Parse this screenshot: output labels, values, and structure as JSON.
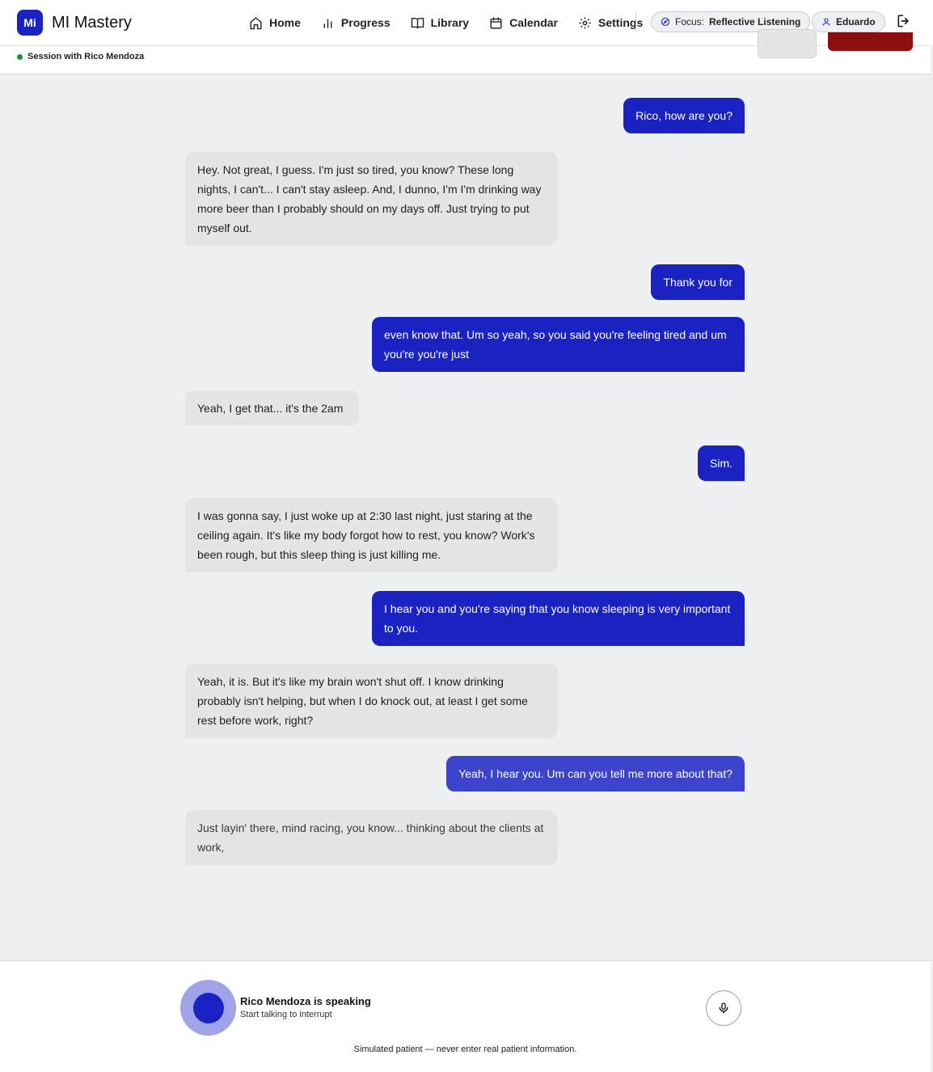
{
  "app": {
    "logo_text": "Mi",
    "title": "MI Mastery",
    "brand_color": "#1a22c4"
  },
  "nav": {
    "items": [
      {
        "label": "Home",
        "icon": "home-icon"
      },
      {
        "label": "Progress",
        "icon": "bar-chart-icon"
      },
      {
        "label": "Library",
        "icon": "book-icon"
      },
      {
        "label": "Calendar",
        "icon": "calendar-icon"
      },
      {
        "label": "Settings",
        "icon": "gear-icon"
      }
    ],
    "focus_prefix": "Focus:",
    "focus_value": "Reflective Listening",
    "user_name": "Eduardo"
  },
  "session": {
    "label": "Session with Rico Mendoza",
    "status_color": "#1e8c3a"
  },
  "messages": [
    {
      "role": "user",
      "text": "Rico, how are you?"
    },
    {
      "role": "patient",
      "text": "Hey. Not great, I guess. I'm just so tired, you know? These long nights, I can't... I can't stay asleep. And, I dunno, I'm I'm drinking way more beer than I probably should on my days off. Just trying to put myself out."
    },
    {
      "role": "user",
      "text": "Thank you for"
    },
    {
      "role": "user",
      "text": "even know that. Um so yeah, so you said you're feeling tired and um you're you're just"
    },
    {
      "role": "patient",
      "text": "Yeah, I get that... it's the 2am"
    },
    {
      "role": "user",
      "text": "Sim."
    },
    {
      "role": "patient",
      "text": "I was gonna say, I just woke up at 2:30 last night, just staring at the ceiling again. It's like my body forgot how to rest, you know? Work's been rough, but this sleep thing is just killing me."
    },
    {
      "role": "user",
      "text": "I hear you and you're saying that you know sleeping is very important to you."
    },
    {
      "role": "patient",
      "text": "Yeah, it is. But it's like my brain won't shut off. I know drinking probably isn't helping, but when I do knock out, at least I get some rest before work, right?"
    },
    {
      "role": "user",
      "text": "Yeah, I hear you. Um can you tell me more about that?"
    },
    {
      "role": "patient",
      "text": "Just layin' there, mind racing, you know... thinking about the clients at work,"
    }
  ],
  "voice": {
    "title": "Rico Mendoza is speaking",
    "subtitle": "Start talking to interrupt"
  },
  "disclaimer": "Simulated patient — never enter real patient information."
}
